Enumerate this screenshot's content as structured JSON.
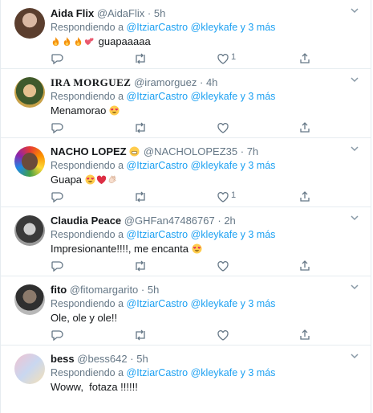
{
  "replying_prefix": "Respondiendo a",
  "mention_1": "@ItziarCastro",
  "mention_2": "@kleykafe",
  "and_more": "y 3 más",
  "tweets": [
    {
      "name": "Aida Flix",
      "handle": "@AidaFlix",
      "time": "5h",
      "text": "guapaaaaa",
      "emojis": [
        "fire",
        "fire",
        "fire",
        "two-hearts"
      ],
      "like_count": "1"
    },
    {
      "name": "IRA MORGUEZ",
      "handle": "@iramorguez",
      "time": "4h",
      "text": "Menamorao",
      "emojis": [
        "heart-eyes"
      ],
      "like_count": ""
    },
    {
      "name": "NACHO LOPEZ",
      "handle": "@NACHOLOPEZ35",
      "time": "7h",
      "text": "Guapa",
      "emojis": [
        "heart-eyes",
        "red-heart",
        "clapping-hands"
      ],
      "like_count": "1"
    },
    {
      "name": "Claudia Peace",
      "handle": "@GHFan47486767",
      "time": "2h",
      "text": "Impresionante!!!!, me encanta",
      "emojis": [
        "heart-eyes"
      ],
      "like_count": ""
    },
    {
      "name": "fito",
      "handle": "@fitomargarito",
      "time": "5h",
      "text": "Ole, ole y ole!!",
      "emojis": [],
      "like_count": ""
    },
    {
      "name": "bess",
      "handle": "@bess642",
      "time": "5h",
      "text": "Woww,  fotaza !!!!!!",
      "emojis": [],
      "like_count": ""
    }
  ],
  "colors": {
    "link": "#1da1f2",
    "secondary": "#657786",
    "border": "#e6ecf0"
  }
}
